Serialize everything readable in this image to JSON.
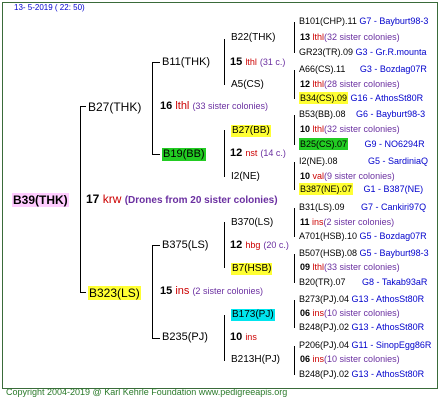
{
  "header": {
    "date": "13-  5-2019 (  22:  50)"
  },
  "footer": {
    "copyright": "Copyright 2004-2019 @ Karl Kehrle Foundation    www.pedigreeapis.org"
  },
  "root": {
    "name": "B39(THK)",
    "num": "17",
    "abbr": "krw",
    "note": "(Drones from 20 sister colonies)"
  },
  "gen1": [
    {
      "name": "B27(THK)",
      "num": "16",
      "abbr": "lthl",
      "note": "(33 sister colonies)"
    },
    {
      "name": "B323(LS)",
      "num": "15",
      "abbr": "ins",
      "note": "(2 sister colonies)"
    }
  ],
  "gen2": [
    {
      "name": "B11(THK)",
      "num": "15",
      "abbr": "lthl",
      "note": "(31 c.)"
    },
    {
      "name": "B19(BB)",
      "num": "12",
      "abbr": "nst",
      "note": "(14 c.)"
    },
    {
      "name": "B375(LS)",
      "num": "12",
      "abbr": "hbg",
      "note": "(20 c.)"
    },
    {
      "name": "B235(PJ)",
      "num": "10",
      "abbr": "ins",
      "note": ""
    }
  ],
  "gen3": [
    {
      "name": "B22(THK)",
      "num": "13",
      "abbr": "lthl",
      "note": "(32 sister colonies)"
    },
    {
      "name": "A5(CS)",
      "num": "12",
      "abbr": "lthl",
      "note": "(28 sister colonies)"
    },
    {
      "name": "B27(BB)",
      "num": "10",
      "abbr": "lthl",
      "note": "(32 sister colonies)"
    },
    {
      "name": "I2(NE)",
      "num": "10",
      "abbr": "val",
      "note": "(9 sister colonies)"
    },
    {
      "name": "B370(LS)",
      "num": "11",
      "abbr": "ins",
      "note": "(2 sister colonies)"
    },
    {
      "name": "B7(HSB)",
      "num": "09",
      "abbr": "lthl",
      "note": "(33 sister colonies)"
    },
    {
      "name": "B173(PJ)",
      "num": "06",
      "abbr": "ins",
      "note": "(10 sister colonies)"
    },
    {
      "name": "B213H(PJ)",
      "num": "06",
      "abbr": "ins",
      "note": "(10 sister colonies)"
    }
  ],
  "gen4": [
    {
      "name": "B101(CHP).11",
      "src": "G7 - Bayburt98-3"
    },
    {
      "name": "GR23(TR).09",
      "src": "G3 - Gr.R.mounta"
    },
    {
      "name": "A66(CS).11",
      "src": "G3 - Bozdag07R"
    },
    {
      "name": "B34(CS).09",
      "src": "G16 - AthosSt80R"
    },
    {
      "name": "B53(BB).08",
      "src": "G6 - Bayburt98-3"
    },
    {
      "name": "B25(CS).07",
      "src": "G9 - NO6294R"
    },
    {
      "name": "I2(NE).08",
      "src": "G5 - SardiniaQ"
    },
    {
      "name": "B387(NE).07",
      "src": "G1 - B387(NE)"
    },
    {
      "name": "B31(LS).09",
      "src": "G7 - Cankiri97Q"
    },
    {
      "name": "A701(HSB).10",
      "src": "G5 - Bozdag07R"
    },
    {
      "name": "B507(HSB).08",
      "src": "G5 - Bayburt98-3"
    },
    {
      "name": "B20(TR).07",
      "src": "G8 - Takab93aR"
    },
    {
      "name": "B273(PJ).04",
      "src": "G13 - AthosSt80R"
    },
    {
      "name": "B248(PJ).02",
      "src": "G13 - AthosSt80R"
    },
    {
      "name": "P206(PJ).04",
      "src": "G11 - SinopEgg86R"
    },
    {
      "name": "B248(PJ).02",
      "src": "G13 - AthosSt80R"
    }
  ],
  "colors": {
    "highlight_yellow": "#ffff33",
    "highlight_green": "#22cc22",
    "highlight_cyan": "#00e5ee",
    "root_pink": "#ffccff",
    "frame": "#3a6b3a"
  }
}
